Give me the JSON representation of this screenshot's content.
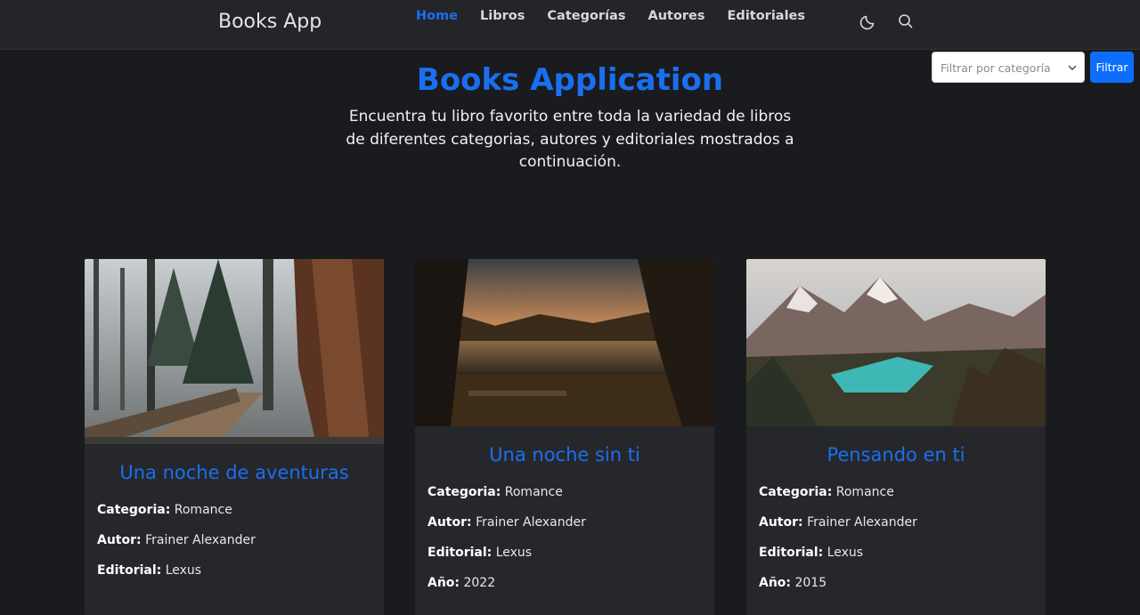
{
  "nav": {
    "brand": "Books App",
    "links": [
      {
        "label": "Home"
      },
      {
        "label": "Libros"
      },
      {
        "label": "Categorías"
      },
      {
        "label": "Autores"
      },
      {
        "label": "Editoriales"
      }
    ]
  },
  "filter": {
    "placeholder": "Filtrar por categoría",
    "button": "Filtrar"
  },
  "hero": {
    "title": "Books Application",
    "text": "Encuentra tu libro favorito entre toda la variedad de libros de diferentes categorias, autores y editoriales mostrados a continuación."
  },
  "labels": {
    "categoria": "Categoria:",
    "autor": "Autor:",
    "editorial": "Editorial:",
    "anio": "Año:"
  },
  "cards": [
    {
      "title": "Una noche de aventuras",
      "categoria": "Romance",
      "autor": "Frainer Alexander",
      "editorial": "Lexus"
    },
    {
      "title": "Una noche sin ti",
      "categoria": "Romance",
      "autor": "Frainer Alexander",
      "editorial": "Lexus",
      "anio": "2022"
    },
    {
      "title": "Pensando en ti",
      "categoria": "Romance",
      "autor": "Frainer Alexander",
      "editorial": "Lexus",
      "anio": "2015"
    }
  ],
  "colors": {
    "accent": "#1a6ff0",
    "button": "#0d6efd",
    "background": "#1a1b1e"
  },
  "icons": [
    "moon-icon",
    "search-icon",
    "chevron-down-icon"
  ]
}
